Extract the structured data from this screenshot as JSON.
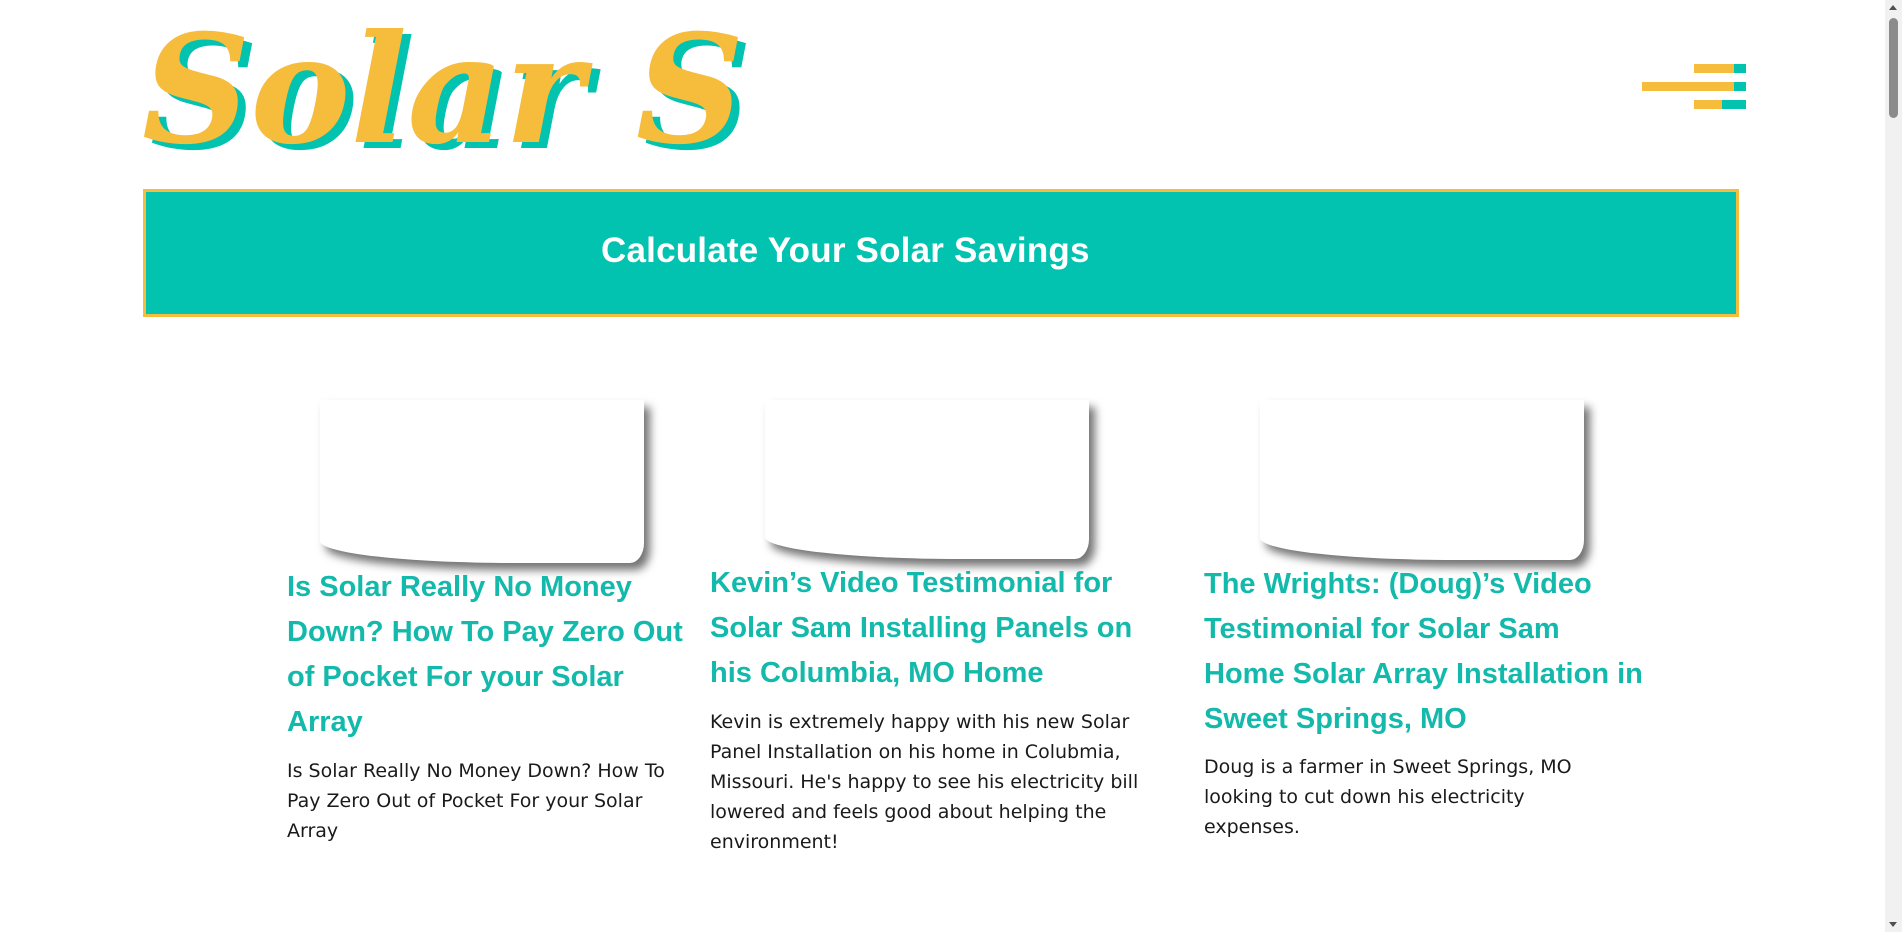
{
  "header": {
    "logo_text": "Solar Sam",
    "logo_word_1": "Solar",
    "logo_word_2": "Sam",
    "logo_colors": {
      "primary": "#f6bc3c",
      "shadow": "#02c2b0"
    },
    "menu_icon": "hamburger-menu-icon"
  },
  "cta": {
    "label": "Calculate Your Solar Savings",
    "background": "#02c2b0",
    "border": "#f6bc3c"
  },
  "posts": [
    {
      "title": "Is Solar Really No Money Down? How To Pay Zero Out of Pocket For your Solar Array",
      "excerpt": "Is Solar Really No Money Down? How To Pay Zero Out of Pocket For your Solar Array"
    },
    {
      "title": "Kevin’s Video Testimonial for Solar Sam Installing Panels on his Columbia, MO Home",
      "excerpt": "Kevin is extremely happy with his new Solar Panel Installation on his home in Colubmia, Missouri. He's happy to see his electricity bill lowered and feels good about helping the environment!"
    },
    {
      "title": "The Wrights: (Doug)’s Video Testimonial for Solar Sam Home Solar Array Installation in Sweet Springs, MO",
      "excerpt": "Doug is a farmer in Sweet Springs, MO looking to cut down his electricity expenses."
    }
  ],
  "colors": {
    "title": "#13b9ab",
    "text": "#1a1a1a",
    "accent_yellow": "#f6bc3c",
    "accent_teal": "#02c2b0"
  }
}
